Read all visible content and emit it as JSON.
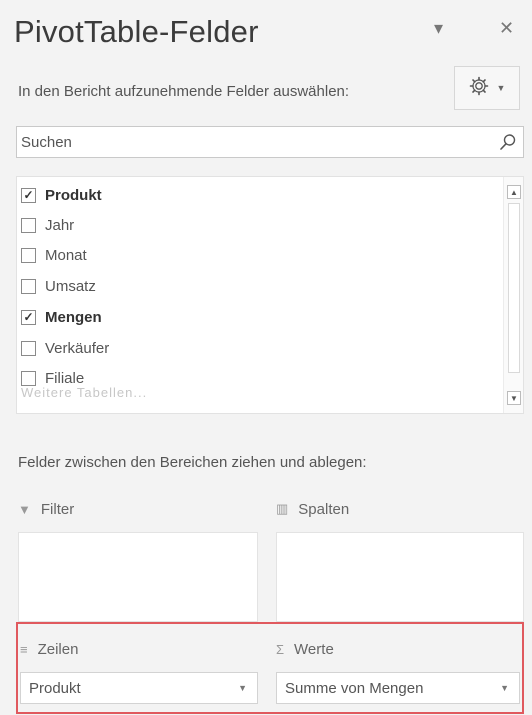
{
  "header": {
    "title": "PivotTable-Felder",
    "dropdown_icon": "▾",
    "close_icon": "✕"
  },
  "fields_section": {
    "label": "In den Bericht aufzunehmende Felder auswählen:",
    "settings_icon": "gear-icon"
  },
  "search": {
    "placeholder": "Suchen"
  },
  "fields": [
    {
      "label": "Produkt",
      "checked": true
    },
    {
      "label": "Jahr",
      "checked": false
    },
    {
      "label": "Monat",
      "checked": false
    },
    {
      "label": "Umsatz",
      "checked": false
    },
    {
      "label": "Mengen",
      "checked": true
    },
    {
      "label": "Verkäufer",
      "checked": false
    },
    {
      "label": "Filiale",
      "checked": false
    }
  ],
  "fields_more_hint": "Weitere Tabellen...",
  "areas_label": "Felder zwischen den Bereichen ziehen und ablegen:",
  "areas": {
    "filter": {
      "label": "Filter",
      "icon": "filter-icon"
    },
    "columns": {
      "label": "Spalten",
      "icon": "columns-icon"
    },
    "rows": {
      "label": "Zeilen",
      "icon": "rows-icon",
      "value": "Produkt"
    },
    "values": {
      "label": "Werte",
      "icon": "sigma-icon",
      "value": "Summe von Mengen"
    }
  },
  "colors": {
    "highlight_border": "#e0595e",
    "background": "#f3f3f3"
  }
}
